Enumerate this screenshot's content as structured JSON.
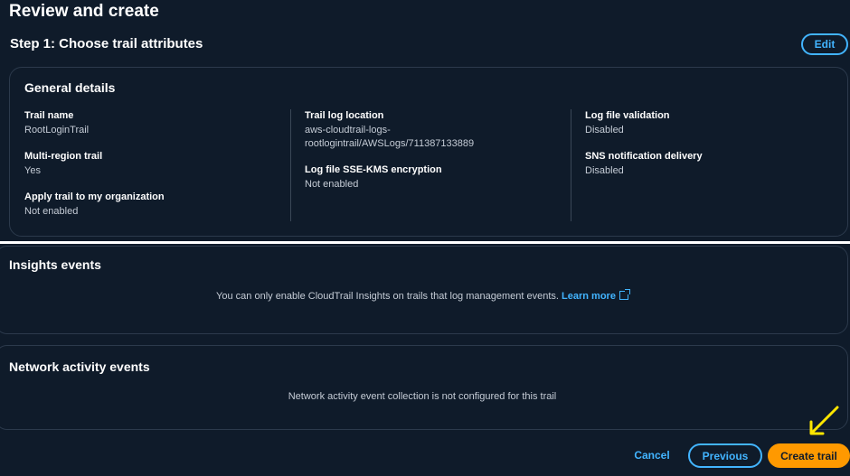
{
  "page": {
    "title": "Review and create",
    "step_title": "Step 1: Choose trail attributes",
    "edit_label": "Edit"
  },
  "general_details": {
    "title": "General details",
    "fields": [
      {
        "label": "Trail name",
        "value": "RootLoginTrail"
      },
      {
        "label": "Multi-region trail",
        "value": "Yes"
      },
      {
        "label": "Apply trail to my organization",
        "value": "Not enabled"
      },
      {
        "label": "Trail log location",
        "value_line1": "aws-cloudtrail-logs-",
        "value_line2": "rootlogintrail/AWSLogs/711387133889"
      },
      {
        "label": "Log file SSE-KMS encryption",
        "value": "Not enabled"
      },
      {
        "label": "Log file validation",
        "value": "Disabled"
      },
      {
        "label": "SNS notification delivery",
        "value": "Disabled"
      }
    ]
  },
  "insights": {
    "title": "Insights events",
    "message": "You can only enable CloudTrail Insights on trails that log management events.",
    "link_label": "Learn more",
    "link_icon": "external-link-icon"
  },
  "network": {
    "title": "Network activity events",
    "message": "Network activity event collection is not configured for this trail"
  },
  "footer": {
    "cancel_label": "Cancel",
    "previous_label": "Previous",
    "create_label": "Create trail"
  },
  "colors": {
    "background": "#0f1b2a",
    "accent": "#42b4ff",
    "primary_button": "#ff9900",
    "annotation_arrow": "#ffe600"
  }
}
